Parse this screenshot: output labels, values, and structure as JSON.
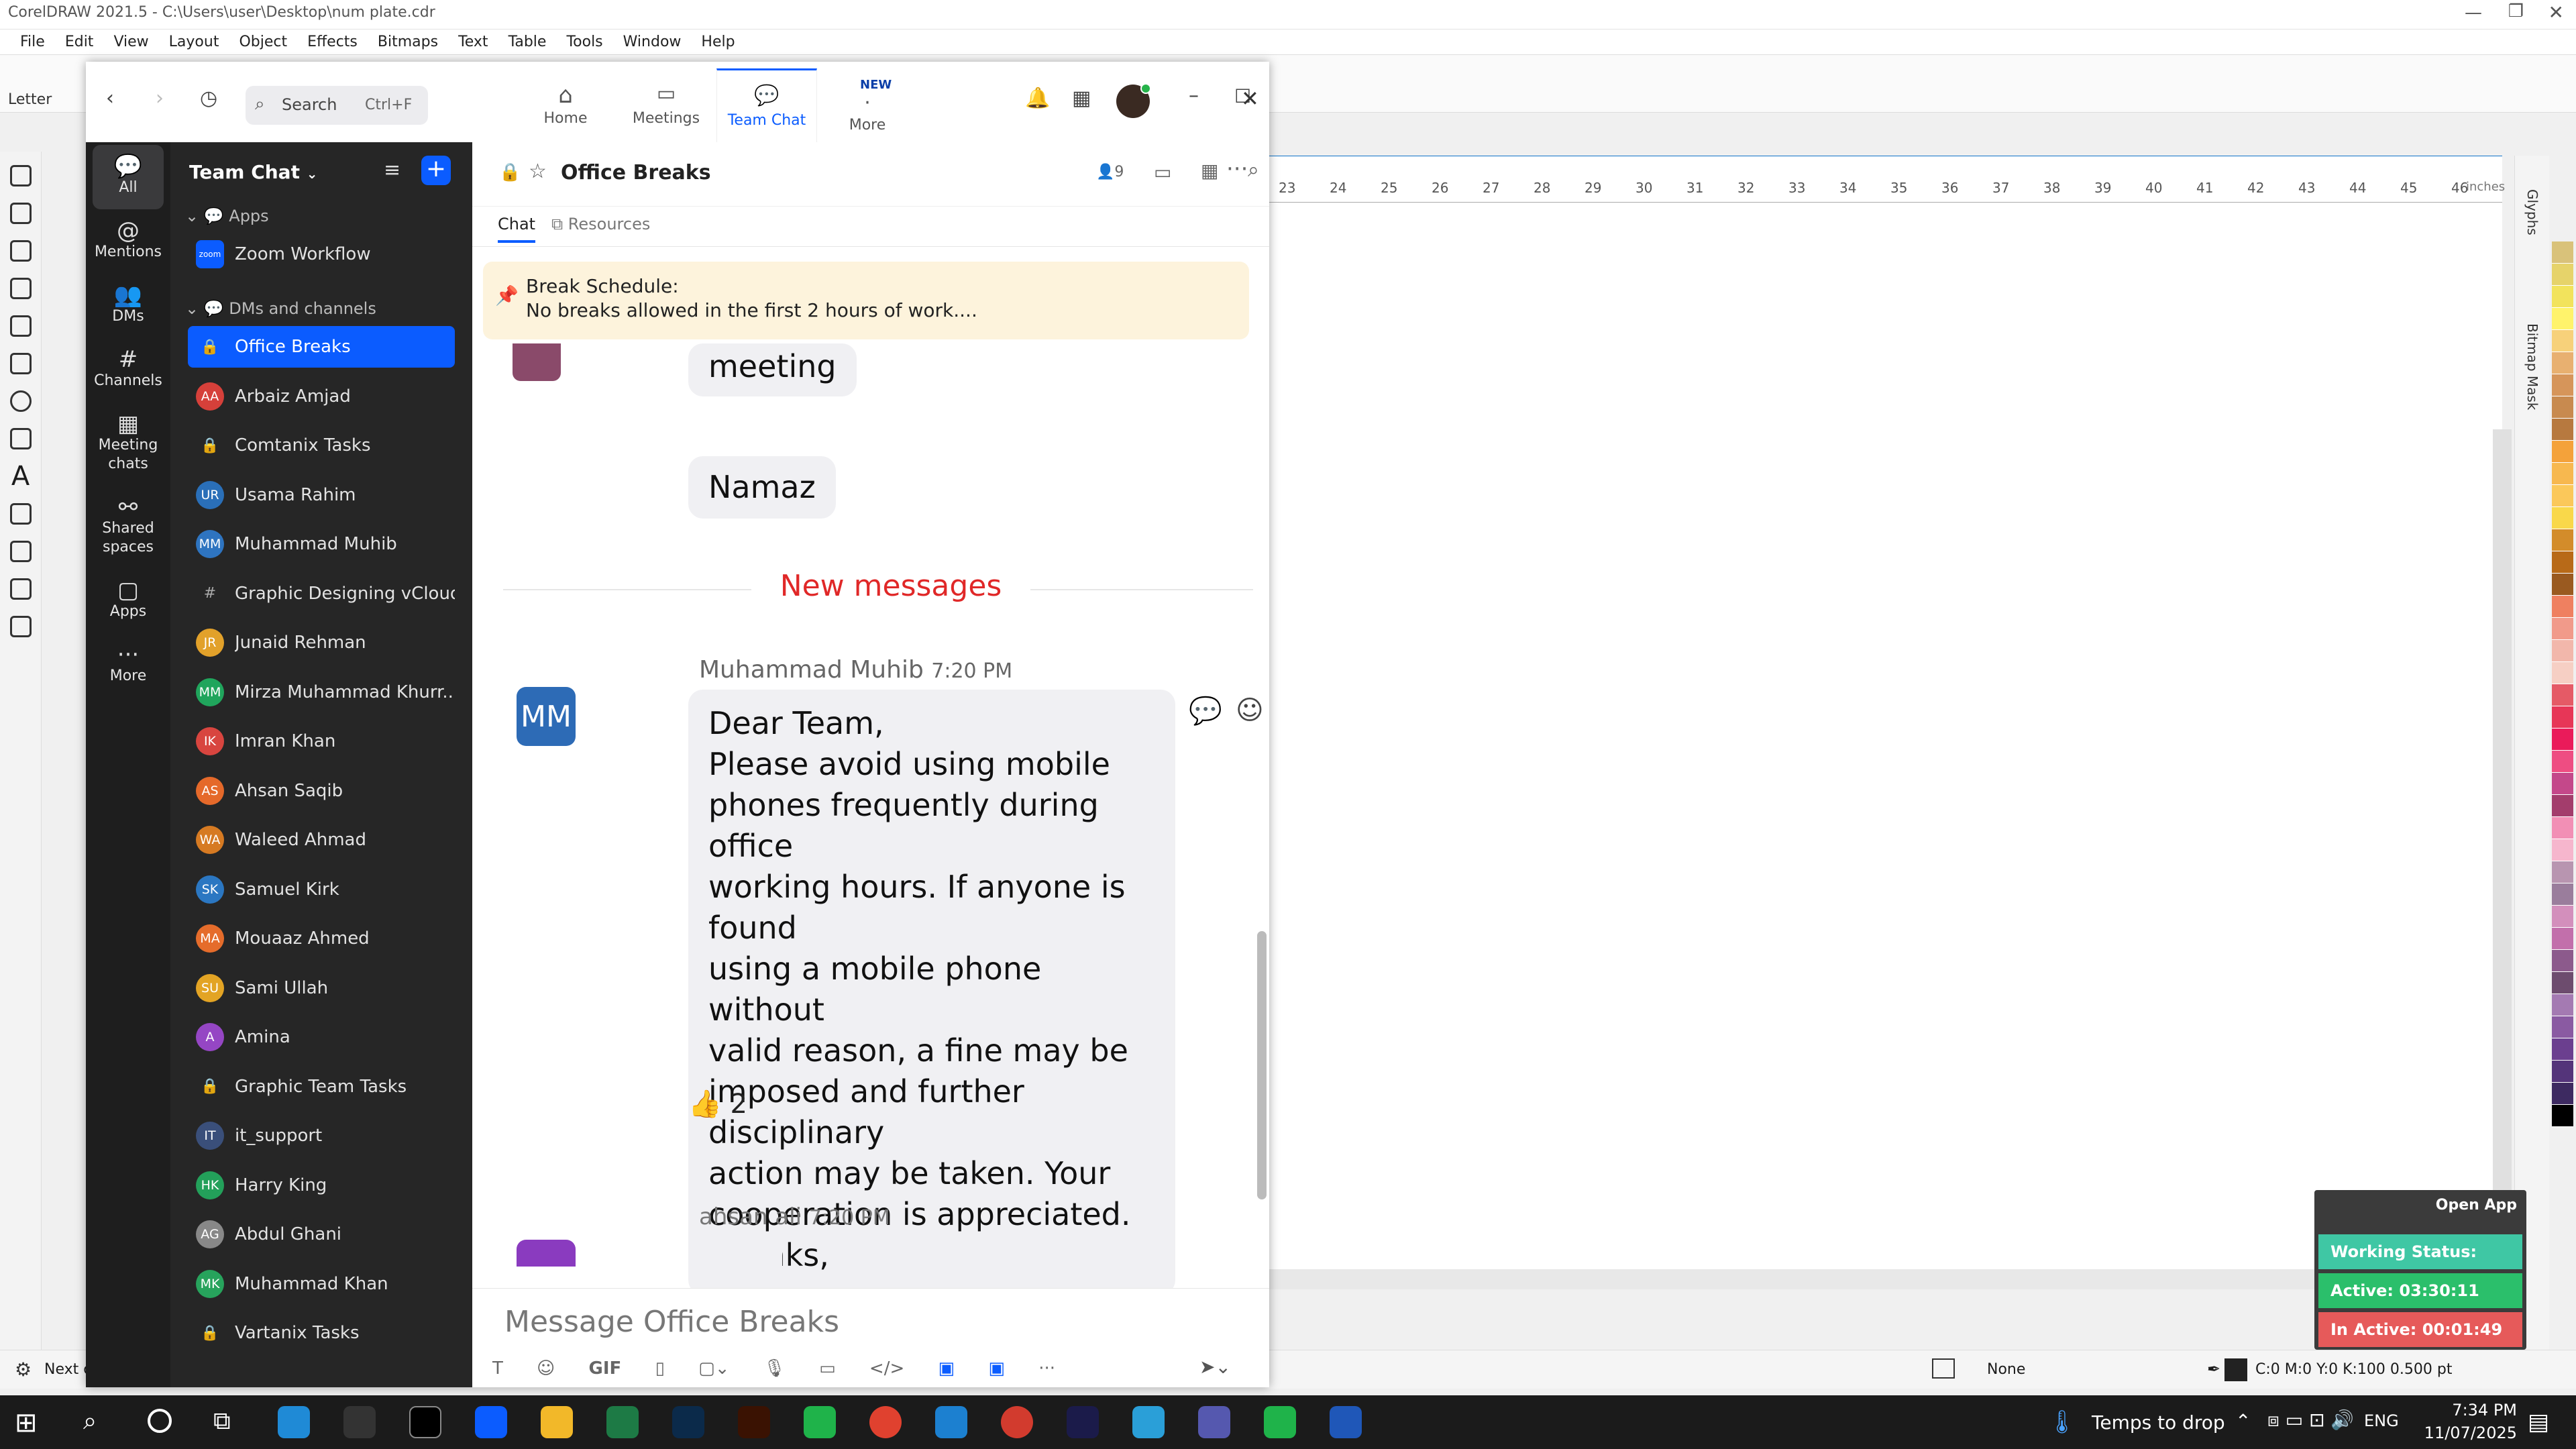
{
  "coreldraw": {
    "title": "CorelDRAW 2021.5 - C:\\Users\\user\\Desktop\\num plate.cdr",
    "menu": [
      "File",
      "Edit",
      "View",
      "Layout",
      "Object",
      "Effects",
      "Bitmaps",
      "Text",
      "Table",
      "Tools",
      "Window",
      "Help"
    ],
    "paper_size": "Letter",
    "ruler_marks": [
      "23",
      "24",
      "25",
      "26",
      "27",
      "28",
      "29",
      "30",
      "31",
      "32",
      "33",
      "34",
      "35",
      "36",
      "37",
      "38",
      "39",
      "40",
      "41",
      "42",
      "43",
      "44",
      "45",
      "46"
    ],
    "ruler_unit": "inches",
    "side_tabs": [
      "Glyphs",
      "Bitmap Mask"
    ],
    "status_fill": "None",
    "status_outline": "C:0 M:0 Y:0 K:100  0.500 pt",
    "status_left": "Next c",
    "palette": [
      "#d9c27a",
      "#e6d36a",
      "#f2e35c",
      "#fff36b",
      "#f7d17a",
      "#e8b070",
      "#d6955a",
      "#c88a4f",
      "#b7793f",
      "#f4a23a",
      "#f7b84f",
      "#fbc85a",
      "#f9d84a",
      "#d38c2a",
      "#b86a18",
      "#9a5a20",
      "#ef8060",
      "#f19a8a",
      "#f2b7ab",
      "#f6cfc4",
      "#e55a66",
      "#e73657",
      "#ea1b5a",
      "#ee4d82",
      "#c4488a",
      "#a33d6c",
      "#f28fb5",
      "#f6b6cd",
      "#b895b0",
      "#9a7d9c",
      "#d38fbc",
      "#c26fab",
      "#8c5a8c",
      "#6d4c6e",
      "#a47ab2",
      "#8a5aa2",
      "#6b3f8f",
      "#54347a",
      "#3d2a61",
      "#000000"
    ]
  },
  "zoom": {
    "search_label": "Search",
    "search_shortcut": "Ctrl+F",
    "nav": [
      {
        "label": "Home"
      },
      {
        "label": "Meetings"
      },
      {
        "label": "Team Chat"
      },
      {
        "label": "More",
        "badge": "NEW"
      }
    ],
    "rail": [
      {
        "label": "All",
        "icon": "chat-bubble-icon"
      },
      {
        "label": "Mentions",
        "icon": "at-icon"
      },
      {
        "label": "DMs",
        "icon": "people-icon"
      },
      {
        "label": "Channels",
        "icon": "hash-icon"
      },
      {
        "label": "Meeting chats",
        "icon": "calendar-icon"
      },
      {
        "label": "Shared spaces",
        "icon": "share-icon"
      },
      {
        "label": "Apps",
        "icon": "apps-icon"
      },
      {
        "label": "More",
        "icon": "dots-icon"
      }
    ],
    "sidebar": {
      "title": "Team Chat",
      "section_apps": "Apps",
      "app_item": "Zoom Workflow",
      "section_dms": "DMs and channels",
      "items": [
        {
          "name": "Office Breaks",
          "type": "lock",
          "selected": true
        },
        {
          "name": "Arbaiz Amjad",
          "initials": "AA",
          "color": "#d6403a"
        },
        {
          "name": "Comtanix Tasks",
          "type": "lock"
        },
        {
          "name": "Usama Rahim",
          "initials": "UR",
          "color": "#2a6fb8"
        },
        {
          "name": "Muhammad Muhib",
          "initials": "MM",
          "color": "#2e74c0"
        },
        {
          "name": "Graphic Designing vCloud",
          "type": "hash"
        },
        {
          "name": "Junaid Rehman",
          "initials": "JR",
          "color": "#e2a12a"
        },
        {
          "name": "Mirza Muhammad Khurr...",
          "initials": "MM",
          "color": "#20a55c"
        },
        {
          "name": "Imran Khan",
          "initials": "IK",
          "color": "#d8453f"
        },
        {
          "name": "Ahsan Saqib",
          "initials": "AS",
          "color": "#e5692a"
        },
        {
          "name": "Waleed Ahmad",
          "initials": "WA",
          "color": "#d67a22"
        },
        {
          "name": "Samuel Kirk",
          "initials": "SK",
          "color": "#2b77c2"
        },
        {
          "name": "Mouaaz Ahmed",
          "initials": "MA",
          "color": "#e56c2b"
        },
        {
          "name": "Sami Ullah",
          "initials": "SU",
          "color": "#e3a424"
        },
        {
          "name": "Amina",
          "initials": "A",
          "color": "#9546c4"
        },
        {
          "name": "Graphic Team Tasks",
          "type": "lock"
        },
        {
          "name": "it_support",
          "initials": "IT",
          "color": "#3a4f7a"
        },
        {
          "name": "Harry King",
          "initials": "HK",
          "color": "#23a05a"
        },
        {
          "name": "Abdul Ghani",
          "initials": "AG",
          "color": "#888888"
        },
        {
          "name": "Muhammad Khan",
          "initials": "MK",
          "color": "#27a35c"
        },
        {
          "name": "Vartanix Tasks",
          "type": "lock"
        }
      ]
    },
    "channel": {
      "name": "Office Breaks",
      "members": "9",
      "tabs": [
        "Chat",
        "Resources"
      ],
      "pinned_title": "Break Schedule:",
      "pinned_text": "No breaks allowed in the first 2 hours of work....",
      "earlier_bubbles": [
        "meeting",
        "Namaz"
      ],
      "new_messages": "New messages",
      "message": {
        "sender": "Muhammad Muhib",
        "time": "7:20 PM",
        "avatar": "MM",
        "lines": [
          "Dear Team,",
          "Please avoid using mobile",
          "phones frequently during office",
          "working hours. If anyone is found",
          "using a mobile phone without",
          "valid reason, a fine may be",
          "imposed and further disciplinary",
          "action may be taken. Your",
          "cooperation is appreciated.",
          "Thanks,"
        ],
        "reaction_emoji": "👍",
        "reaction_count": "2"
      },
      "next_sender": "ahsan ali",
      "next_time": "7:20 PM",
      "composer_placeholder": "Message Office Breaks",
      "composer_gif": "GIF"
    }
  },
  "timer_widget": {
    "open_app": "Open App",
    "status": "Working Status: Active",
    "active": "Active: 03:30:11",
    "inactive": "In Active: 00:01:49"
  },
  "taskbar": {
    "weather": "Temps to drop",
    "lang": "ENG",
    "time": "7:34 PM",
    "date": "11/07/2025"
  }
}
